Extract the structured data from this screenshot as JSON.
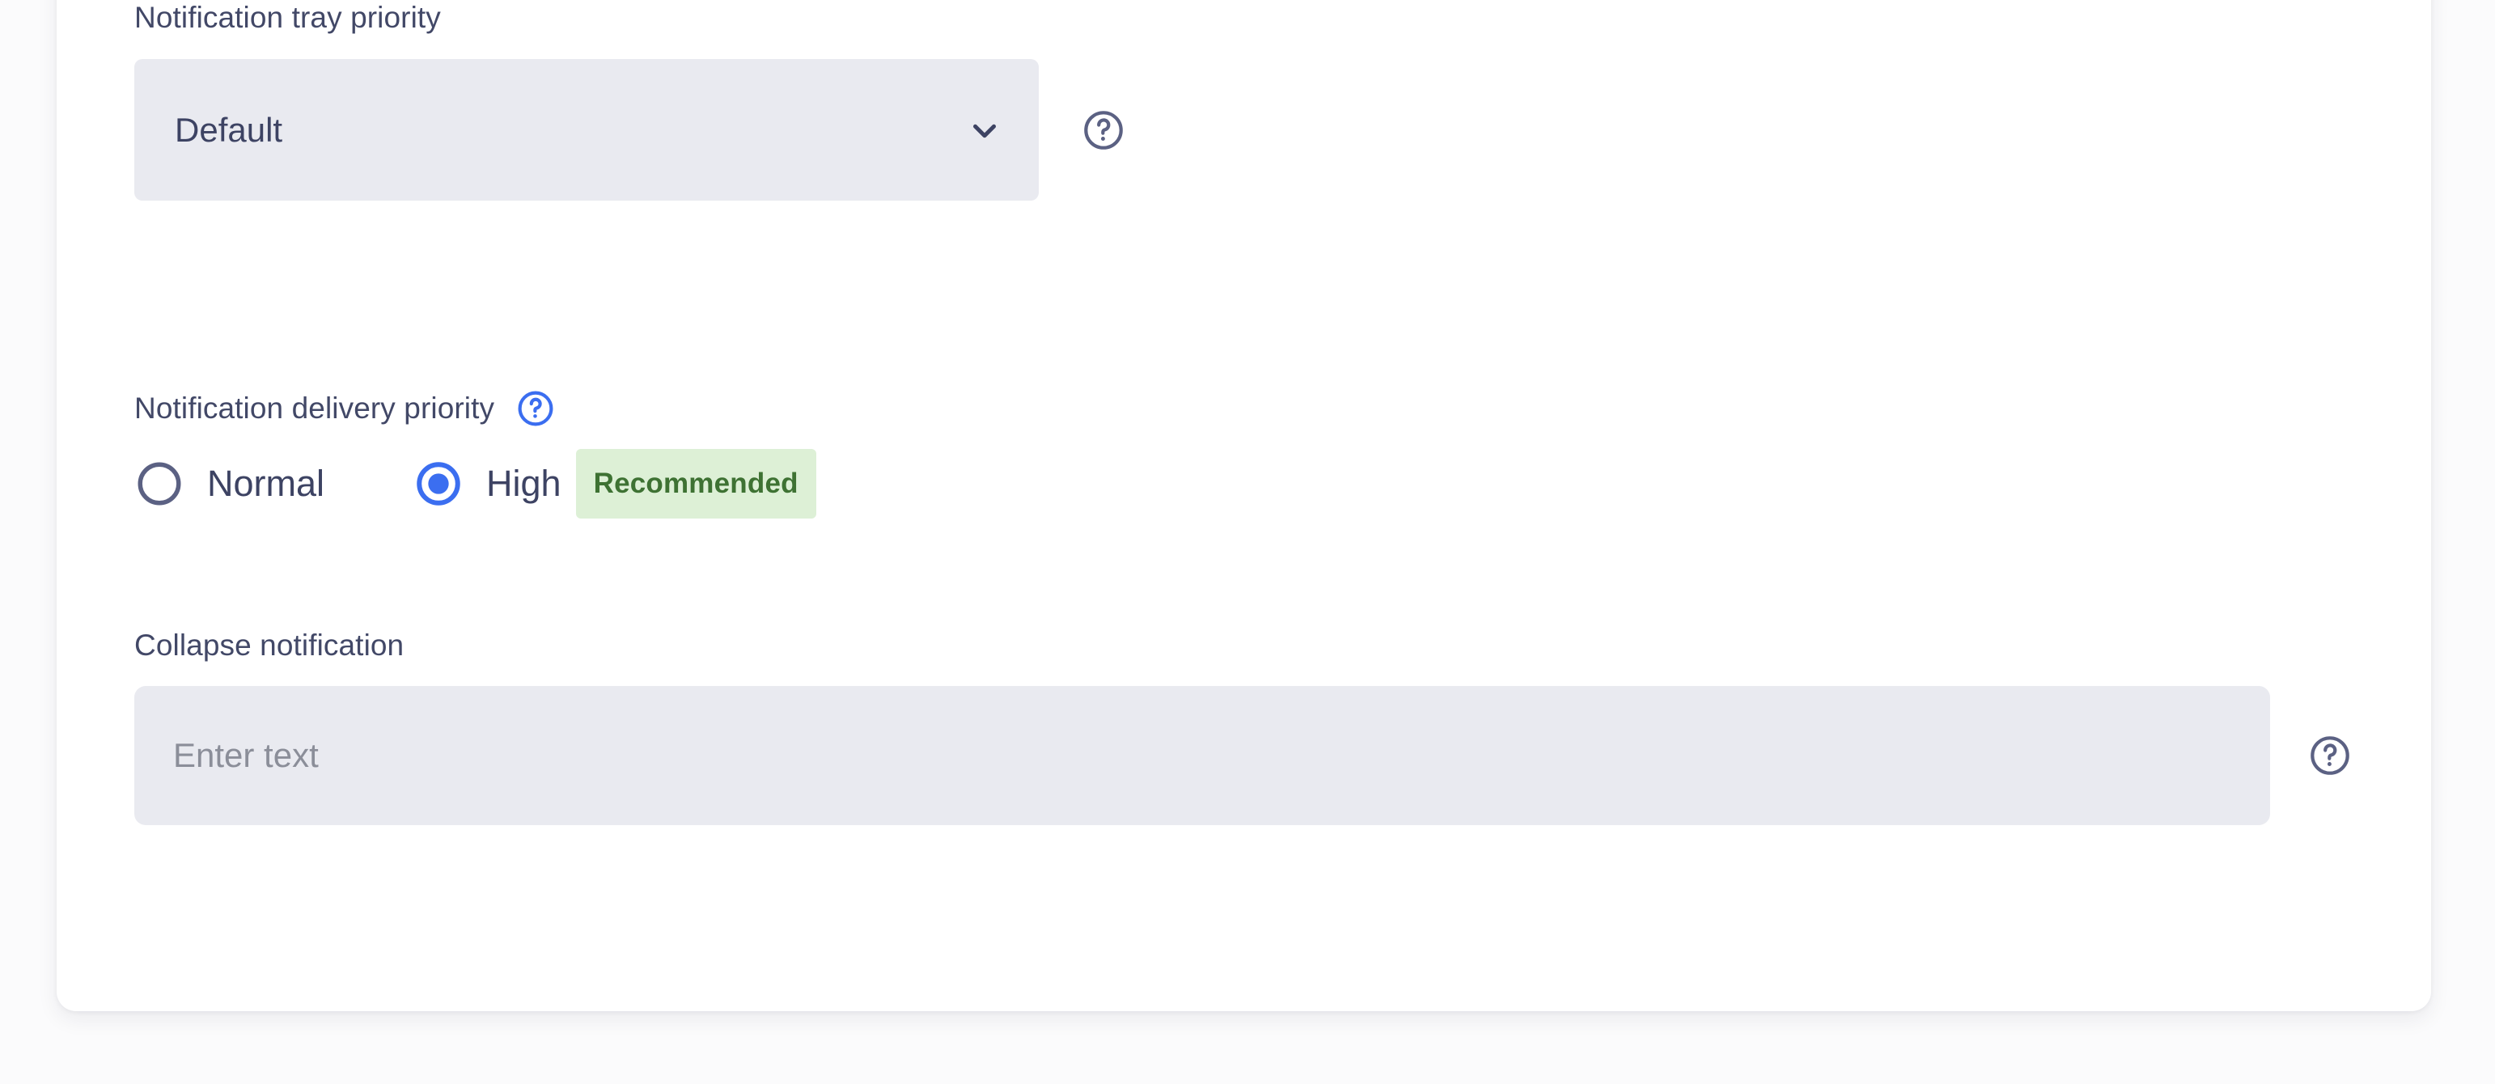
{
  "colors": {
    "page_background": "#fbfbfc",
    "card_background": "#ffffff",
    "field_fill": "#e9eaf0",
    "label_text": "#424867",
    "value_text": "#3d4363",
    "placeholder_text": "#8b8e99",
    "accent_blue": "#3b6ef0",
    "help_icon_slate": "#5b6183",
    "badge_background": "#ddf0d6",
    "badge_text": "#3e7233"
  },
  "form": {
    "tray_priority": {
      "label": "Notification tray priority",
      "selected_value": "Default",
      "chevron_icon": "chevron-down-icon",
      "help_icon": "help-circle-icon"
    },
    "delivery_priority": {
      "label": "Notification delivery priority",
      "help_icon": "help-circle-icon",
      "selected": "High",
      "options": [
        {
          "label": "Normal",
          "selected": false,
          "badge": ""
        },
        {
          "label": "High",
          "selected": true,
          "badge": "Recommended"
        }
      ]
    },
    "collapse_notification": {
      "label": "Collapse notification",
      "value": "",
      "placeholder": "Enter text",
      "help_icon": "help-circle-icon"
    }
  }
}
